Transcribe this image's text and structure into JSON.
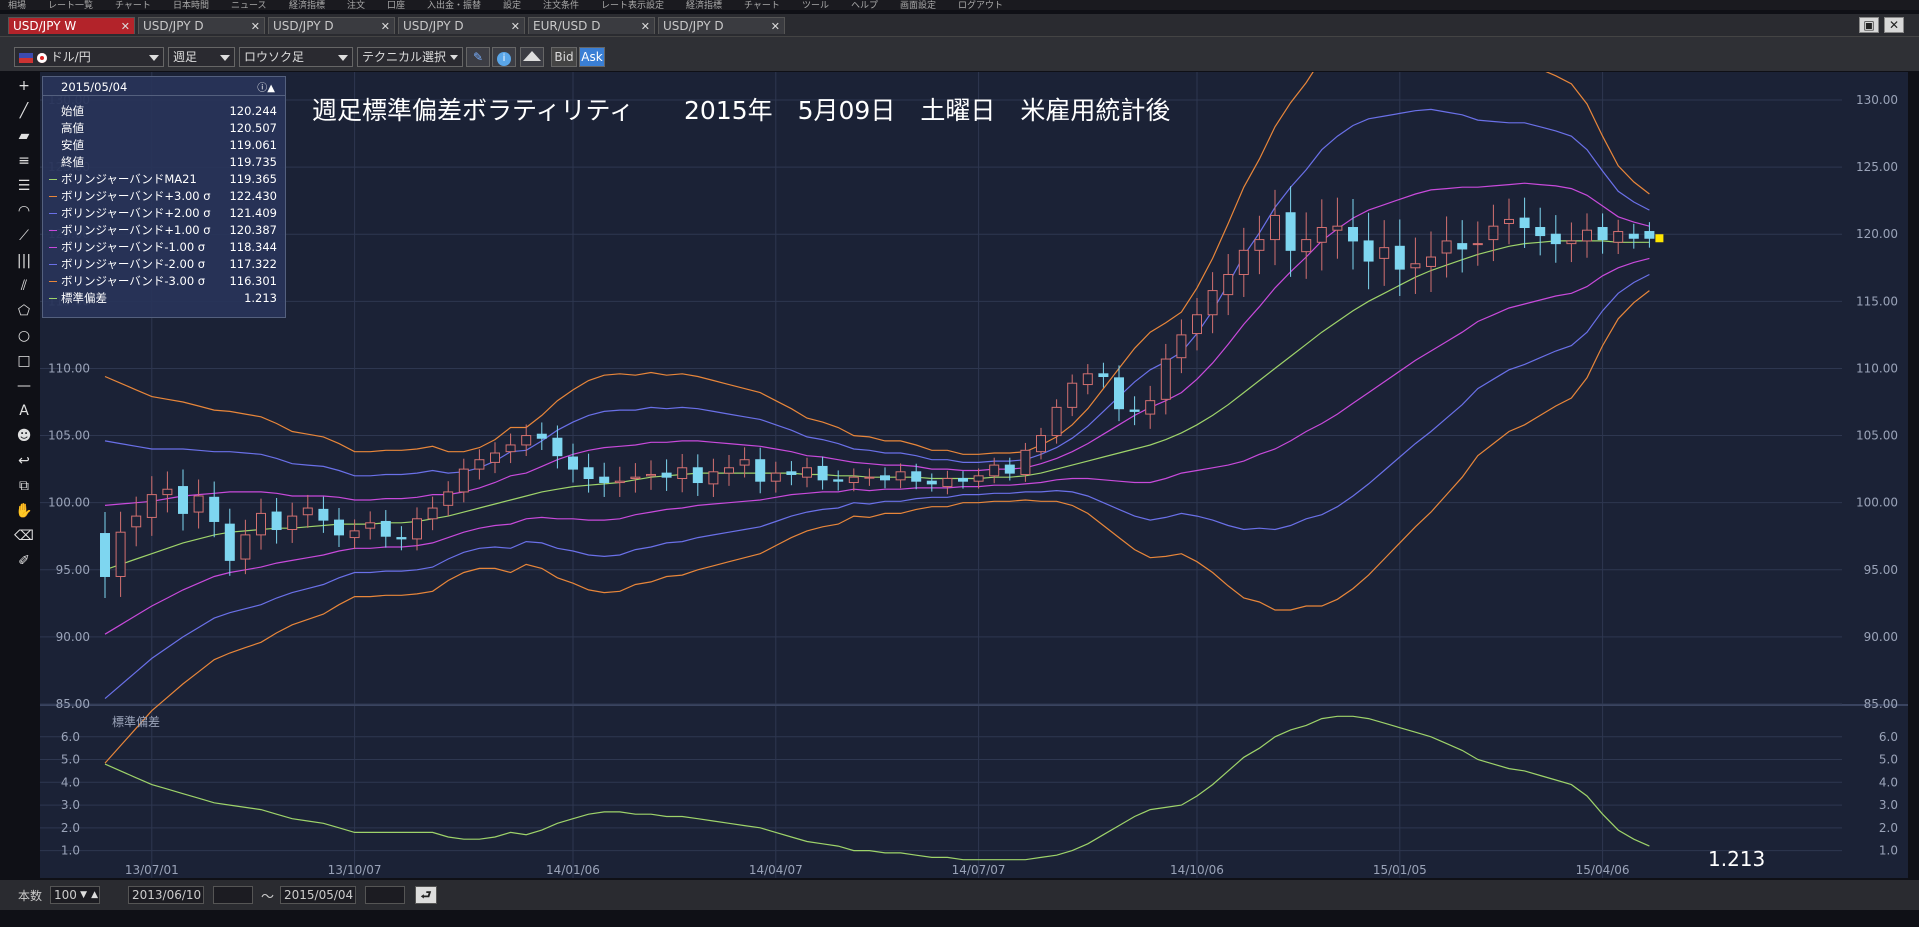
{
  "menu": {
    "items": [
      "相場",
      "レート一覧",
      "チャート",
      "日本時間",
      "ニュース",
      "経済指標",
      "注文",
      "口座",
      "入出金・振替",
      "設定",
      "注文条件",
      "レート表示設定",
      "経済指標",
      "チャート",
      "ツール",
      "ヘルプ",
      "画面設定",
      "ログアウト"
    ]
  },
  "tabs": [
    {
      "label": "USD/JPY W",
      "active": true
    },
    {
      "label": "USD/JPY D",
      "active": false
    },
    {
      "label": "USD/JPY D",
      "active": false
    },
    {
      "label": "USD/JPY D",
      "active": false
    },
    {
      "label": "EUR/USD D",
      "active": false
    },
    {
      "label": "USD/JPY D",
      "active": false
    }
  ],
  "toolbar": {
    "pair": "ドル/円",
    "period": "週足",
    "chart_type": "ロウソク足",
    "technical": "テクニカル選択",
    "bid": "Bid",
    "ask": "Ask"
  },
  "info": {
    "date": "2015/05/04",
    "rows": [
      {
        "label": "始値",
        "value": "120.244",
        "color": ""
      },
      {
        "label": "高値",
        "value": "120.507",
        "color": ""
      },
      {
        "label": "安値",
        "value": "119.061",
        "color": ""
      },
      {
        "label": "終値",
        "value": "119.735",
        "color": ""
      },
      {
        "label": "ボリンジャーバンドMA21",
        "value": "119.365",
        "color": "#9ed36a"
      },
      {
        "label": "ボリンジャーバンド+3.00 σ",
        "value": "122.430",
        "color": "#e8863a"
      },
      {
        "label": "ボリンジャーバンド+2.00 σ",
        "value": "121.409",
        "color": "#6a70e8"
      },
      {
        "label": "ボリンジャーバンド+1.00 σ",
        "value": "120.387",
        "color": "#c84adb"
      },
      {
        "label": "ボリンジャーバンド-1.00 σ",
        "value": "118.344",
        "color": "#c84adb"
      },
      {
        "label": "ボリンジャーバンド-2.00 σ",
        "value": "117.322",
        "color": "#6a70e8"
      },
      {
        "label": "ボリンジャーバンド-3.00 σ",
        "value": "116.301",
        "color": "#e8863a"
      },
      {
        "label": "標準偏差",
        "value": "1.213",
        "color": "#9ed36a"
      }
    ]
  },
  "annotation": "週足標準偏差ボラティリティ　　2015年　5月09日　土曜日　米雇用統計後",
  "sub_title": "標準偏差",
  "last_std": "1.213",
  "bottom": {
    "count_label": "本数",
    "count": "100",
    "from": "2013/06/10",
    "tilde": "～",
    "to": "2015/05/04"
  },
  "colors": {
    "bg": "#1b2236",
    "up": "#d27070",
    "down": "#7ed6f0",
    "ma": "#9ed36a",
    "s1": "#c84adb",
    "s2": "#6a70e8",
    "s3": "#e8863a"
  },
  "chart_data": {
    "type": "line",
    "title": "週足標準偏差ボラティリティ　　2015年　5月09日　土曜日　米雇用統計後",
    "x_tick_labels": [
      "13/07/01",
      "13/10/07",
      "14/01/06",
      "14/04/07",
      "14/07/07",
      "14/10/06",
      "15/01/05",
      "15/04/06"
    ],
    "x_tick_index": [
      3,
      16,
      30,
      43,
      56,
      70,
      83,
      96
    ],
    "main": {
      "ylim": [
        85,
        130
      ],
      "yticks": [
        "130.00",
        "125.00",
        "120.00",
        "115.00",
        "110.00",
        "105.00",
        "100.00",
        "95.00",
        "90.00",
        "85.00"
      ],
      "candles_close": [
        94.5,
        97.8,
        99.0,
        100.6,
        101.0,
        99.2,
        100.5,
        98.6,
        95.7,
        97.6,
        99.2,
        98.0,
        99.0,
        99.6,
        98.7,
        97.6,
        97.9,
        98.5,
        97.5,
        97.3,
        98.8,
        99.6,
        100.8,
        102.5,
        103.2,
        103.7,
        104.3,
        105.0,
        104.8,
        103.5,
        102.5,
        101.8,
        101.5,
        101.6,
        101.9,
        102.1,
        101.9,
        102.6,
        101.5,
        102.3,
        102.6,
        103.2,
        101.6,
        102.2,
        102.1,
        102.6,
        101.7,
        101.6,
        101.9,
        101.9,
        101.7,
        102.3,
        101.6,
        101.4,
        101.8,
        101.6,
        102.0,
        102.8,
        102.2,
        103.9,
        105.0,
        107.1,
        108.9,
        109.6,
        109.4,
        107.0,
        106.8,
        107.6,
        110.7,
        112.5,
        114.0,
        115.8,
        117.0,
        118.8,
        119.6,
        121.4,
        118.8,
        119.6,
        120.5,
        120.6,
        119.5,
        118.0,
        119.0,
        117.4,
        117.8,
        118.3,
        119.5,
        118.9,
        119.3,
        120.6,
        121.1,
        120.5,
        119.9,
        119.3,
        119.5,
        120.3,
        119.6,
        120.2,
        119.7,
        119.7
      ],
      "candles_open": [
        97.7,
        94.5,
        98.2,
        98.9,
        100.6,
        101.2,
        99.3,
        100.4,
        98.4,
        95.8,
        97.6,
        99.3,
        98.0,
        99.1,
        99.5,
        98.7,
        97.4,
        98.1,
        98.6,
        97.4,
        97.3,
        98.8,
        99.8,
        100.8,
        102.5,
        103.0,
        103.8,
        104.3,
        105.1,
        104.8,
        103.4,
        102.6,
        101.9,
        101.5,
        101.8,
        102.0,
        102.2,
        101.8,
        102.6,
        101.4,
        102.2,
        102.8,
        103.2,
        101.6,
        102.3,
        101.9,
        102.7,
        101.7,
        101.5,
        101.9,
        102.0,
        101.7,
        102.3,
        101.6,
        101.2,
        101.8,
        101.6,
        102.0,
        102.8,
        102.1,
        103.8,
        105.0,
        107.1,
        108.8,
        109.6,
        109.3,
        106.9,
        106.6,
        107.7,
        110.8,
        112.6,
        114.0,
        115.5,
        117.0,
        118.8,
        119.6,
        121.6,
        118.7,
        119.4,
        120.3,
        120.5,
        119.5,
        118.2,
        119.1,
        117.5,
        117.6,
        118.6,
        119.3,
        119.3,
        119.6,
        120.8,
        121.2,
        120.5,
        120.0,
        119.3,
        119.5,
        120.5,
        119.4,
        120.0,
        120.2
      ],
      "ma21": [
        95.0,
        95.4,
        95.8,
        96.2,
        96.6,
        97.0,
        97.3,
        97.6,
        97.8,
        97.9,
        98.0,
        98.1,
        98.1,
        98.2,
        98.3,
        98.4,
        98.4,
        98.4,
        98.5,
        98.5,
        98.6,
        98.8,
        99.0,
        99.3,
        99.6,
        99.9,
        100.2,
        100.5,
        100.8,
        101.0,
        101.2,
        101.3,
        101.4,
        101.5,
        101.7,
        101.9,
        102.0,
        102.1,
        102.2,
        102.2,
        102.2,
        102.2,
        102.2,
        102.2,
        102.2,
        102.1,
        102.1,
        102.0,
        102.0,
        101.9,
        101.9,
        101.9,
        101.9,
        101.8,
        101.8,
        101.8,
        101.8,
        101.9,
        101.9,
        102.0,
        102.2,
        102.5,
        102.8,
        103.1,
        103.4,
        103.7,
        104.0,
        104.3,
        104.7,
        105.2,
        105.8,
        106.5,
        107.3,
        108.2,
        109.1,
        110.0,
        110.9,
        111.8,
        112.7,
        113.5,
        114.3,
        115.0,
        115.6,
        116.2,
        116.8,
        117.3,
        117.7,
        118.1,
        118.5,
        118.8,
        119.1,
        119.3,
        119.4,
        119.5,
        119.5,
        119.5,
        119.5,
        119.4,
        119.4,
        119.4
      ],
      "sd": [
        4.8,
        4.5,
        4.2,
        3.9,
        3.7,
        3.5,
        3.3,
        3.1,
        3.0,
        2.9,
        2.8,
        2.6,
        2.4,
        2.3,
        2.2,
        2.0,
        1.8,
        1.8,
        1.8,
        1.8,
        1.8,
        1.8,
        1.6,
        1.5,
        1.5,
        1.6,
        1.8,
        1.7,
        1.9,
        2.2,
        2.4,
        2.6,
        2.7,
        2.7,
        2.6,
        2.6,
        2.5,
        2.5,
        2.4,
        2.3,
        2.2,
        2.1,
        2.0,
        1.8,
        1.6,
        1.4,
        1.3,
        1.2,
        1.0,
        1.0,
        0.9,
        0.9,
        0.8,
        0.7,
        0.7,
        0.6,
        0.6,
        0.6,
        0.6,
        0.6,
        0.7,
        0.8,
        1.0,
        1.3,
        1.7,
        2.1,
        2.5,
        2.8,
        2.9,
        3.0,
        3.4,
        3.9,
        4.5,
        5.1,
        5.5,
        6.0,
        6.3,
        6.5,
        6.8,
        6.9,
        6.9,
        6.8,
        6.6,
        6.4,
        6.2,
        6.0,
        5.7,
        5.4,
        5.0,
        4.8,
        4.6,
        4.5,
        4.3,
        4.1,
        3.9,
        3.4,
        2.6,
        1.9,
        1.5,
        1.2
      ]
    },
    "sub": {
      "ylim": [
        0.5,
        7.0
      ],
      "yticks": [
        "6.0",
        "5.0",
        "4.0",
        "3.0",
        "2.0",
        "1.0"
      ]
    }
  }
}
